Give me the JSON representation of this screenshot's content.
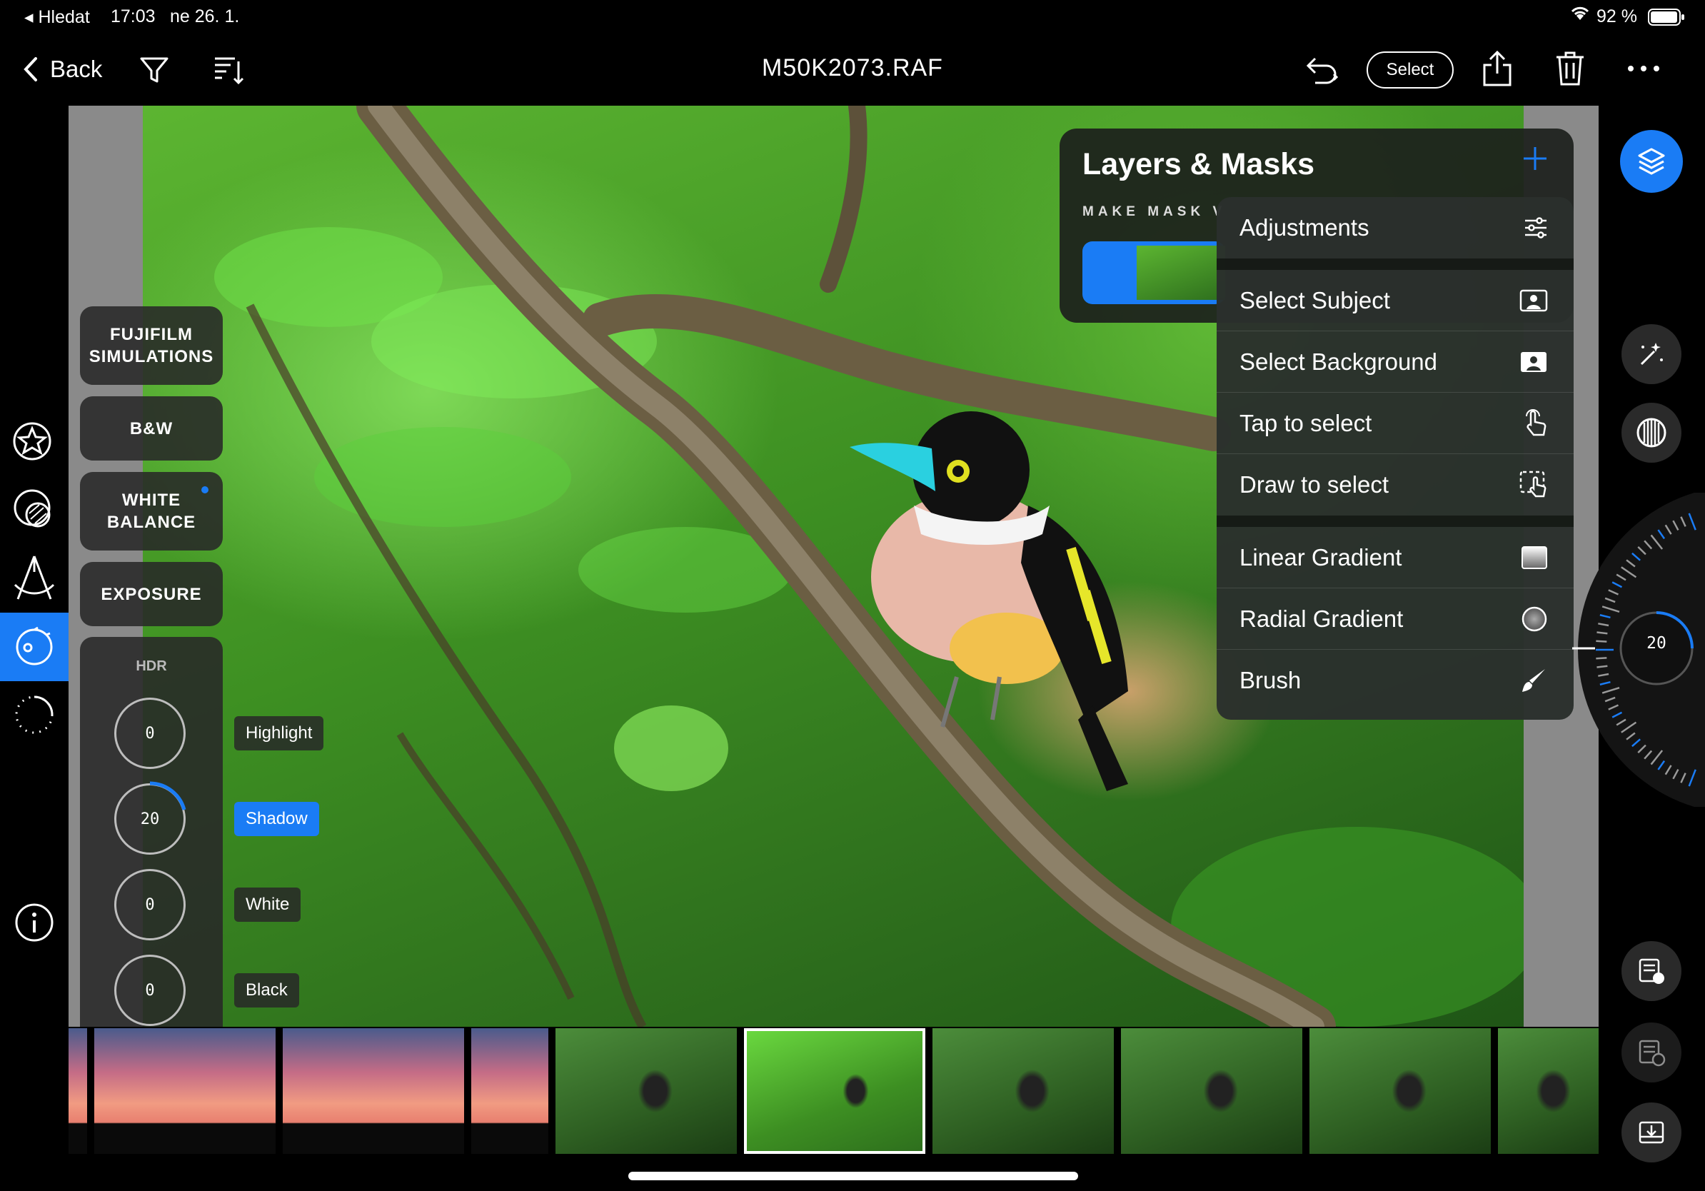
{
  "status_bar": {
    "back_app": "Hledat",
    "time": "17:03",
    "date": "ne 26. 1.",
    "battery": "92 %"
  },
  "toolbar": {
    "back_label": "Back",
    "title": "M50K2073.RAF",
    "select_label": "Select"
  },
  "categories": {
    "fujifilm": "FUJIFILM SIMULATIONS",
    "bw": "B&W",
    "white_balance": "WHITE BALANCE",
    "exposure": "EXPOSURE"
  },
  "hdr": {
    "title": "HDR",
    "controls": [
      {
        "label": "Highlight",
        "value": "0",
        "active": false
      },
      {
        "label": "Shadow",
        "value": "20",
        "active": true
      },
      {
        "label": "White",
        "value": "0",
        "active": false
      },
      {
        "label": "Black",
        "value": "0",
        "active": false
      }
    ]
  },
  "layers_panel": {
    "title": "Layers & Masks",
    "subtitle": "MAKE MASK V",
    "menu": [
      {
        "label": "Adjustments",
        "icon": "sliders-icon"
      },
      {
        "label": "Select Subject",
        "icon": "person-box-icon"
      },
      {
        "label": "Select Background",
        "icon": "person-box-filled-icon"
      },
      {
        "label": "Tap to select",
        "icon": "tap-hand-icon"
      },
      {
        "label": "Draw to select",
        "icon": "draw-select-icon"
      },
      {
        "label": "Linear Gradient",
        "icon": "linear-gradient-icon"
      },
      {
        "label": "Radial Gradient",
        "icon": "radial-gradient-icon"
      },
      {
        "label": "Brush",
        "icon": "brush-icon"
      }
    ]
  },
  "right_dial": {
    "value": "20"
  },
  "colors": {
    "accent": "#1a7cf5",
    "panel": "#282828"
  }
}
